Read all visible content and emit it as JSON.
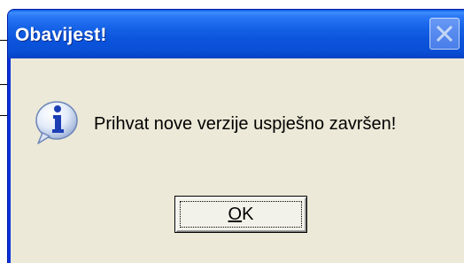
{
  "dialog": {
    "title": "Obavijest!",
    "message": "Prihvat nove verzije uspješno završen!",
    "ok_button": {
      "mnemonic": "O",
      "rest": "K"
    }
  },
  "icons": {
    "close": "close-icon",
    "info": "information-icon"
  },
  "colors": {
    "titlebar": "#0a4fd6",
    "client": "#ece9d8",
    "title_text": "#ffffff"
  }
}
